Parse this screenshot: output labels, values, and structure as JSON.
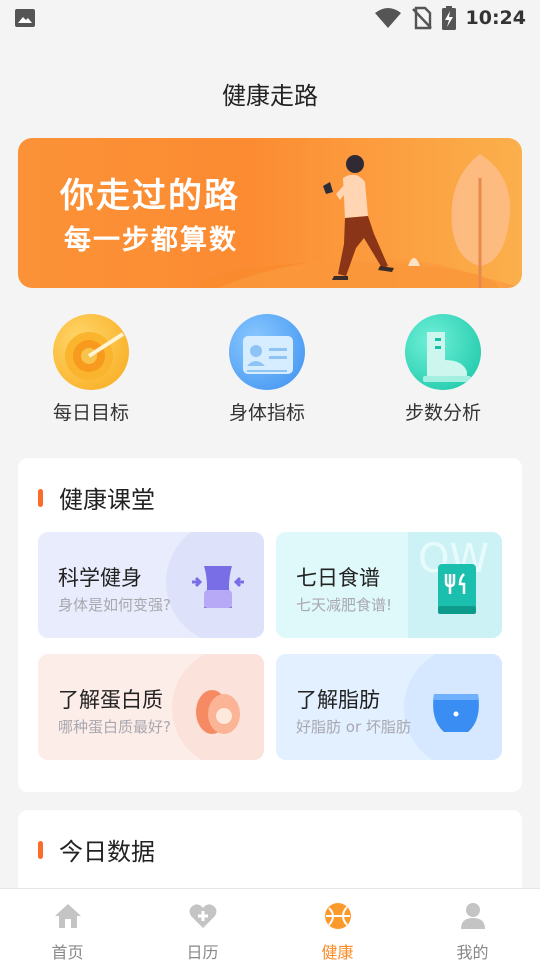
{
  "status_bar": {
    "time": "10:24",
    "icons": [
      "photo-icon",
      "wifi-icon",
      "no-sim-icon",
      "battery-charging-icon"
    ]
  },
  "page_title": "健康走路",
  "banner": {
    "line1": "你走过的路",
    "line2": "每一步都算数"
  },
  "quick_actions": [
    {
      "label": "每日目标",
      "icon": "target-icon"
    },
    {
      "label": "身体指标",
      "icon": "id-card-icon"
    },
    {
      "label": "步数分析",
      "icon": "boot-icon"
    }
  ],
  "health_class": {
    "title": "健康课堂",
    "tiles": [
      {
        "title": "科学健身",
        "subtitle": "身体是如何变强?",
        "icon": "waist-icon"
      },
      {
        "title": "七日食谱",
        "subtitle": "七天减肥食谱!",
        "icon": "recipe-book-icon"
      },
      {
        "title": "了解蛋白质",
        "subtitle": "哪种蛋白质最好?",
        "icon": "egg-icon"
      },
      {
        "title": "了解脂肪",
        "subtitle": "好脂肪 or 坏脂肪",
        "icon": "belly-icon"
      }
    ]
  },
  "today_data": {
    "title": "今日数据"
  },
  "bottom_nav": [
    {
      "label": "首页",
      "icon": "home-icon"
    },
    {
      "label": "日历",
      "icon": "heart-plus-icon"
    },
    {
      "label": "健康",
      "icon": "ball-icon",
      "active": true
    },
    {
      "label": "我的",
      "icon": "person-icon"
    }
  ],
  "colors": {
    "accent": "#fb8a26",
    "banner": "#fc8b32",
    "title_bar": "#fb6c2b"
  }
}
